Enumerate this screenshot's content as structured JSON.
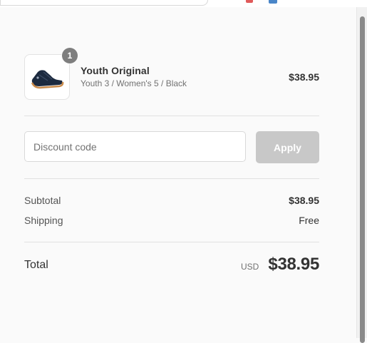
{
  "order_summary": {
    "product": {
      "name": "Youth Original",
      "variant": "Youth 3 / Women's 5 / Black",
      "price": "$38.95",
      "quantity": "1",
      "image_icon": "sandal-icon"
    },
    "discount": {
      "placeholder": "Discount code",
      "value": "",
      "apply_label": "Apply"
    },
    "subtotal": {
      "label": "Subtotal",
      "value": "$38.95"
    },
    "shipping": {
      "label": "Shipping",
      "value": "Free"
    },
    "total": {
      "label": "Total",
      "currency": "USD",
      "value": "$38.95"
    }
  },
  "colors": {
    "background": "#fafafa",
    "apply_disabled": "#c8c8c8",
    "badge": "#7e7e7e",
    "divider": "#e1e1e1"
  }
}
